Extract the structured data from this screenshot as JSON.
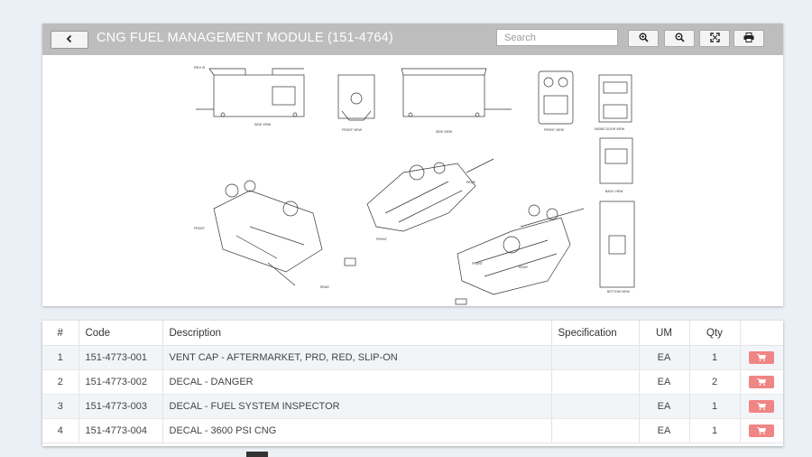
{
  "header": {
    "back_label": "back",
    "title": "CNG FUEL MANAGEMENT MODULE (151-4764)",
    "search_placeholder": "Search"
  },
  "toolbar_icons": [
    "zoom-in-icon",
    "zoom-out-icon",
    "fit-screen-icon",
    "print-icon"
  ],
  "drawing": {
    "rev": "REV B",
    "views": {
      "side1": "SIDE VIEW",
      "front": "FRONT VIEW",
      "side2": "SIDE VIEW",
      "front2": "FRONT VIEW",
      "inside_door": "INSIDE DOOR VIEW",
      "back": "BACK VIEW",
      "bottom": "BOTTOM VIEW",
      "front_iso1": "FRONT",
      "rear_iso1": "REAR",
      "front_iso2": "FRONT",
      "rear_iso2": "REAR",
      "front_iso3": "FRONT",
      "rear_iso3": "REAR"
    }
  },
  "table": {
    "columns": [
      "#",
      "Code",
      "Description",
      "Specification",
      "UM",
      "Qty",
      ""
    ],
    "rows": [
      {
        "num": "1",
        "code": "151-4773-001",
        "description": "VENT CAP - AFTERMARKET, PRD, RED, SLIP-ON",
        "spec": "",
        "um": "EA",
        "qty": "1"
      },
      {
        "num": "2",
        "code": "151-4773-002",
        "description": "DECAL - DANGER",
        "spec": "",
        "um": "EA",
        "qty": "2"
      },
      {
        "num": "3",
        "code": "151-4773-003",
        "description": "DECAL - FUEL SYSTEM INSPECTOR",
        "spec": "",
        "um": "EA",
        "qty": "1"
      },
      {
        "num": "4",
        "code": "151-4773-004",
        "description": "DECAL - 3600 PSI CNG",
        "spec": "",
        "um": "EA",
        "qty": "1"
      }
    ]
  },
  "colors": {
    "toolbar": "#bdbdbd",
    "cart_button": "#f08585",
    "background": "#eaf0f5"
  }
}
